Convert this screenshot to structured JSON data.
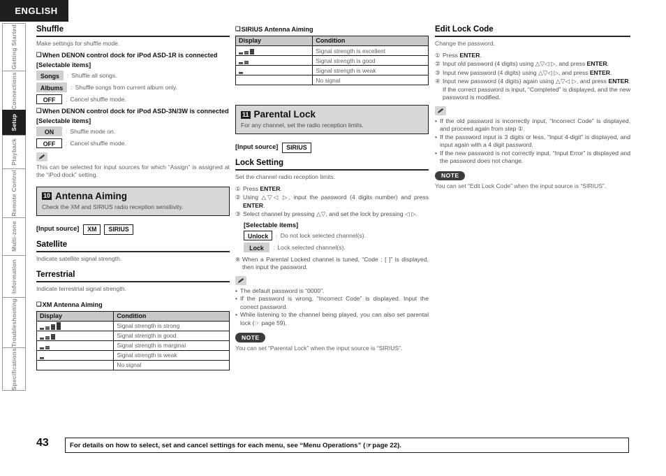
{
  "header": {
    "language_tab": "ENGLISH"
  },
  "sidebar": {
    "items": [
      {
        "label": "Getting Started",
        "active": false
      },
      {
        "label": "Connections",
        "active": false
      },
      {
        "label": "Setup",
        "active": true
      },
      {
        "label": "Playback",
        "active": false
      },
      {
        "label": "Remote Control",
        "active": false
      },
      {
        "label": "Multi-zone",
        "active": false
      },
      {
        "label": "Information",
        "active": false
      },
      {
        "label": "Troubleshooting",
        "active": false
      },
      {
        "label": "Specifications",
        "active": false
      }
    ]
  },
  "left_column": {
    "shuffle": {
      "heading": "Shuffle",
      "intro": "Make settings for shuffle mode.",
      "dock1_heading": "When DENON control dock for iPod ASD-1R is connected",
      "selectable_label_1": "[Selectable items]",
      "options_1": [
        {
          "key": "Songs",
          "style": "filled",
          "desc": "Shuffle all songs."
        },
        {
          "key": "Albums",
          "style": "filled",
          "desc": "Shuffle songs from current album only."
        },
        {
          "key": "OFF",
          "style": "outline",
          "desc": "Cancel shuffle mode."
        }
      ],
      "dock2_heading": "When DENON control dock for iPod ASD-3N/3W is connected",
      "selectable_label_2": "[Selectable items]",
      "options_2": [
        {
          "key": "ON",
          "style": "filled",
          "desc": "Shuffle mode on."
        },
        {
          "key": "OFF",
          "style": "outline",
          "desc": "Cancel shuffle mode."
        }
      ],
      "memo": "This can be selected for input sources for which “Assign” is assigned at the “iPod dock” setting."
    },
    "antenna_aiming": {
      "number": "10",
      "title": "Antenna Aiming",
      "description": "Check the XM and SIRIUS radio reception sensitivity.",
      "input_source_label": "[Input source]",
      "input_sources": [
        "XM",
        "SIRIUS"
      ],
      "satellite": {
        "heading": "Satellite",
        "text": "Indicate satellite signal strength."
      },
      "terrestrial": {
        "heading": "Terrestrial",
        "text": "Indicate terrestrial signal strength."
      },
      "xm_table": {
        "heading": "XM Antenna Aiming",
        "columns": [
          "Display",
          "Condition"
        ],
        "rows": [
          {
            "bars": 4,
            "condition": "Signal strength is strong"
          },
          {
            "bars": 3,
            "condition": "Signal strength is good"
          },
          {
            "bars": 2,
            "condition": "Signal strength is marginal"
          },
          {
            "bars": 1,
            "condition": "Signal strength is weak"
          },
          {
            "bars": 0,
            "condition": "No signal"
          }
        ]
      }
    }
  },
  "mid_column": {
    "sirius_table": {
      "heading": "SIRIUS Antenna Aiming",
      "columns": [
        "Display",
        "Condition"
      ],
      "rows": [
        {
          "bars": 3,
          "condition": "Signal strength is excellent"
        },
        {
          "bars": 2,
          "condition": "Signal strength is good"
        },
        {
          "bars": 1,
          "condition": "Signal strength is weak"
        },
        {
          "bars": 0,
          "condition": "No signal"
        }
      ]
    },
    "parental_lock": {
      "number": "11",
      "title": "Parental Lock",
      "description": "For any channel, set the radio reception limits.",
      "input_source_label": "[Input source]",
      "input_sources": [
        "SIRIUS"
      ],
      "lock_setting": {
        "heading": "Lock Setting",
        "intro": "Set the channel radio reception limits.",
        "steps": [
          {
            "num": "①",
            "text_html": "Press <b>ENTER</b>."
          },
          {
            "num": "②",
            "text_html": "Using △▽◁ ▷, input the password (4 digits number) and press <b>ENTER</b>."
          },
          {
            "num": "③",
            "text_html": "Select channel by pressing △▽, and set the lock by pressing ◁ ▷."
          }
        ],
        "selectable_label": "[Selectable items]",
        "options": [
          {
            "key": "Unlock",
            "style": "outline",
            "desc": "Do not lock selected channel(s)."
          },
          {
            "key": "Lock",
            "style": "filled",
            "desc": "Lock selected channel(s)."
          }
        ],
        "asterisk_note": "When a Parental Locked channel is tuned, “Code : [        ]” is displayed, then input the password.",
        "memo_bullets": [
          "The default password is “0000”.",
          "If the password is wrong, “Incorrect Code” is displayed. Input the correct password.",
          "While listening to the channel being played, you can also set parental lock (☞ page 59)."
        ],
        "note_badge": "NOTE",
        "note_text": "You can set “Parental Lock” when the input source is “SIRIUS”."
      }
    }
  },
  "right_column": {
    "edit_lock_code": {
      "heading": "Edit Lock Code",
      "intro": "Change the password.",
      "steps": [
        {
          "num": "①",
          "text_html": "Press <b>ENTER</b>."
        },
        {
          "num": "②",
          "text_html": "Input old password (4 digits) using △▽◁ ▷, and press <b>ENTER</b>."
        },
        {
          "num": "③",
          "text_html": "Input new password (4 digits) using △▽◁ ▷, and press <b>ENTER</b>."
        },
        {
          "num": "④",
          "text_html": "Input new password (4 digits) again using △▽◁ ▷, and press <b>ENTER</b>. If the correct password is input, “Completed” is displayed, and the new password is modified."
        }
      ],
      "memo_bullets": [
        "If the old password is incorrectly input, “Incorrect Code” is displayed, and proceed again from step ①.",
        "If the password input is 3 digits or less, “Input 4-digit” is displayed, and input again with a 4 digit password.",
        "If the new password is not correctly input, “Input Error” is displayed and the password does not change."
      ],
      "note_badge": "NOTE",
      "note_text": "You can set “Edit Lock Code” when the input source is “SIRIUS”."
    }
  },
  "footer": {
    "page_number": "43",
    "text_before": "For details on how to select, set and cancel settings for each menu, see “Menu Operations” (",
    "hand_icon": "☞",
    "text_after": "page 22)."
  }
}
